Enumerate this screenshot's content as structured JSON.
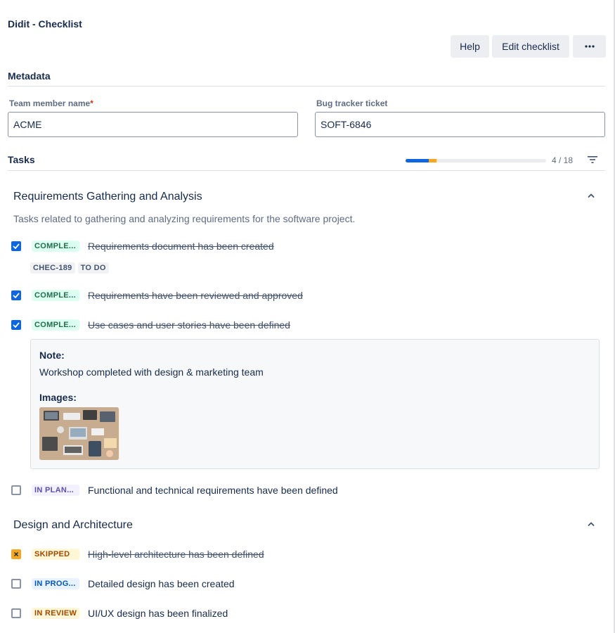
{
  "header": {
    "title": "Didit - Checklist",
    "buttons": {
      "help": "Help",
      "edit": "Edit checklist",
      "more": "···"
    }
  },
  "metadata": {
    "title": "Metadata",
    "fields": [
      {
        "label": "Team member name",
        "required_mark": "*",
        "value": "ACME"
      },
      {
        "label": "Bug tracker ticket",
        "value": "SOFT-6846"
      }
    ]
  },
  "tasks": {
    "title": "Tasks",
    "progress": {
      "count": "4 / 18",
      "done": 3,
      "skipped": 1,
      "total": 18
    }
  },
  "groups": [
    {
      "title": "Requirements Gathering and Analysis",
      "description": "Tasks related to gathering and analyzing requirements for the software project.",
      "tasks": [
        {
          "status": "COMPLE...",
          "text": "Requirements document has been created",
          "chips": [
            "CHEC-189",
            "TO DO"
          ]
        },
        {
          "status": "COMPLE...",
          "text": "Requirements have been reviewed and approved"
        },
        {
          "status": "COMPLE...",
          "text": "Use cases and user stories have been defined",
          "note": {
            "label": "Note:",
            "text": "Workshop completed with design & marketing team",
            "images_label": "Images:"
          }
        },
        {
          "status": "IN PLAN...",
          "text": "Functional and technical requirements have been defined"
        }
      ]
    },
    {
      "title": "Design and Architecture",
      "tasks": [
        {
          "status": "SKIPPED",
          "text": "High-level architecture has been defined"
        },
        {
          "status": "IN PROG...",
          "text": "Detailed design has been created"
        },
        {
          "status": "IN REVIEW",
          "text": "UI/UX design has been finalized"
        }
      ]
    }
  ],
  "colors": {
    "accent": "#0c66e4",
    "skipped": "#f5a623",
    "complete_badge": "#dcfff1",
    "plan_badge": "#f3f0ff",
    "progress_badge": "#e9f2ff",
    "review_badge": "#fff7d6"
  },
  "icons": [
    "more-icon",
    "filter-icon",
    "chevron-up-icon",
    "checkbox-checked-icon",
    "checkbox-skipped-icon",
    "checkbox-empty-icon"
  ]
}
